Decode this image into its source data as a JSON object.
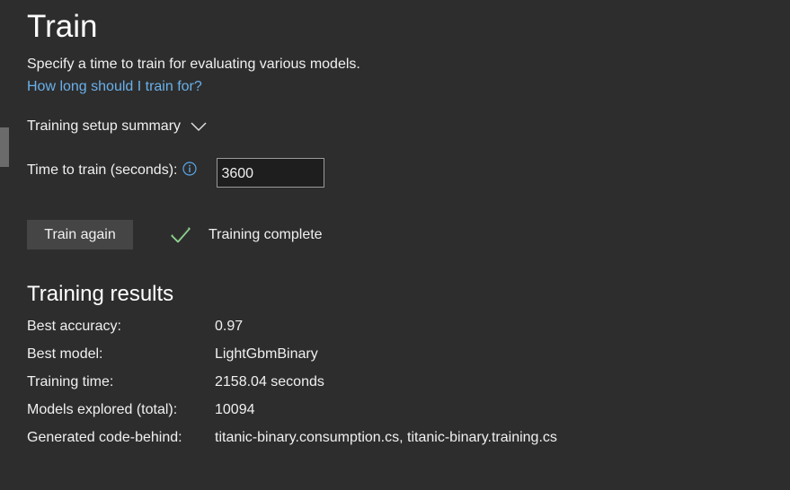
{
  "page": {
    "title": "Train",
    "description": "Specify a time to train for evaluating various models.",
    "help_link": "How long should I train for?"
  },
  "summary": {
    "label": "Training setup summary",
    "icon": "chevron-down-icon"
  },
  "time_to_train": {
    "label": "Time to train (seconds):",
    "info_icon": "info-icon",
    "value": "3600"
  },
  "actions": {
    "train_again_label": "Train again"
  },
  "status": {
    "icon": "checkmark-icon",
    "text": "Training complete",
    "color": "#8fd18f"
  },
  "results": {
    "title": "Training results",
    "rows": [
      {
        "label": "Best accuracy:",
        "value": "0.97"
      },
      {
        "label": "Best model:",
        "value": "LightGbmBinary"
      },
      {
        "label": "Training time:",
        "value": "2158.04 seconds"
      },
      {
        "label": "Models explored (total):",
        "value": "10094"
      },
      {
        "label": "Generated code-behind:",
        "value": "titanic-binary.consumption.cs, titanic-binary.training.cs"
      }
    ]
  },
  "colors": {
    "background": "#2d2d2d",
    "link": "#6ab0ea",
    "button": "#454545"
  }
}
